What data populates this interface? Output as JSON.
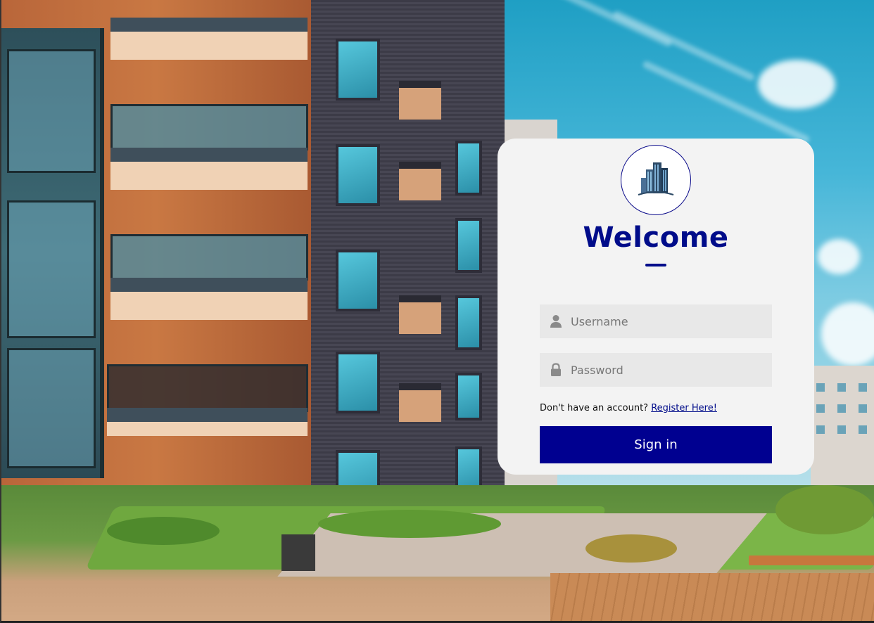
{
  "scene": {
    "background": "apartment-building-photo"
  },
  "login": {
    "logo_icon": "building-logo-icon",
    "title": "Welcome",
    "username": {
      "placeholder": "Username",
      "value": "",
      "icon": "user-icon"
    },
    "password": {
      "placeholder": "Password",
      "value": "",
      "icon": "lock-icon"
    },
    "register_prompt": "Don't have an account?",
    "register_link": "Register Here!",
    "submit_label": "Sign in"
  },
  "colors": {
    "accent": "#000c8a",
    "button": "#000090",
    "card": "#f3f3f3",
    "field": "#e8e8e8"
  }
}
